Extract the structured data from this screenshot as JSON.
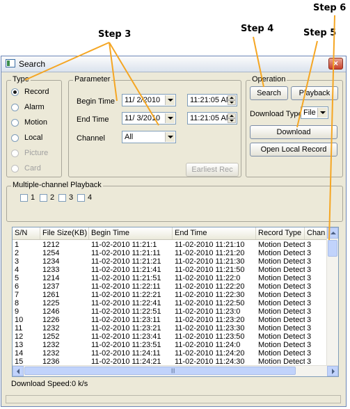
{
  "annotations": {
    "step3": "Step 3",
    "step4": "Step 4",
    "step5": "Step 5",
    "step6": "Step 6"
  },
  "window": {
    "title": "Search",
    "close_label": "×"
  },
  "type_group": {
    "legend": "Type",
    "options": [
      {
        "label": "Record",
        "checked": true,
        "enabled": true
      },
      {
        "label": "Alarm",
        "checked": false,
        "enabled": true
      },
      {
        "label": "Motion",
        "checked": false,
        "enabled": true
      },
      {
        "label": "Local",
        "checked": false,
        "enabled": true
      },
      {
        "label": "Picture",
        "checked": false,
        "enabled": false
      },
      {
        "label": "Card",
        "checked": false,
        "enabled": false
      }
    ]
  },
  "parameter": {
    "legend": "Parameter",
    "begin_label": "Begin Time",
    "begin_date": "11/  2/2010",
    "begin_time": "11:21:05 AM",
    "end_label": "End Time",
    "end_date": "11/  3/2010",
    "end_time": "11:21:05 AM",
    "channel_label": "Channel",
    "channel_value": "All",
    "earliest_button": "Earliest Rec"
  },
  "operation": {
    "legend": "Operation",
    "search_button": "Search",
    "playback_button": "Playback",
    "download_type_label": "Download Type",
    "download_type_value": "File",
    "download_button": "Download",
    "open_local_button": "Open Local Record"
  },
  "multichannel": {
    "legend": "Multiple-channel Playback",
    "channels": [
      "1",
      "2",
      "3",
      "4"
    ]
  },
  "table": {
    "columns": [
      "S/N",
      "File Size(KB)",
      "Begin Time",
      "End Time",
      "Record Type",
      "Chan"
    ],
    "rows": [
      [
        "1",
        "1212",
        "11-02-2010 11:21:1",
        "11-02-2010 11:21:10",
        "Motion Detect",
        "3"
      ],
      [
        "2",
        "1254",
        "11-02-2010 11:21:11",
        "11-02-2010 11:21:20",
        "Motion Detect",
        "3"
      ],
      [
        "3",
        "1234",
        "11-02-2010 11:21:21",
        "11-02-2010 11:21:30",
        "Motion Detect",
        "3"
      ],
      [
        "4",
        "1233",
        "11-02-2010 11:21:41",
        "11-02-2010 11:21:50",
        "Motion Detect",
        "3"
      ],
      [
        "5",
        "1214",
        "11-02-2010 11:21:51",
        "11-02-2010 11:22:0",
        "Motion Detect",
        "3"
      ],
      [
        "6",
        "1237",
        "11-02-2010 11:22:11",
        "11-02-2010 11:22:20",
        "Motion Detect",
        "3"
      ],
      [
        "7",
        "1261",
        "11-02-2010 11:22:21",
        "11-02-2010 11:22:30",
        "Motion Detect",
        "3"
      ],
      [
        "8",
        "1225",
        "11-02-2010 11:22:41",
        "11-02-2010 11:22:50",
        "Motion Detect",
        "3"
      ],
      [
        "9",
        "1246",
        "11-02-2010 11:22:51",
        "11-02-2010 11:23:0",
        "Motion Detect",
        "3"
      ],
      [
        "10",
        "1226",
        "11-02-2010 11:23:11",
        "11-02-2010 11:23:20",
        "Motion Detect",
        "3"
      ],
      [
        "11",
        "1232",
        "11-02-2010 11:23:21",
        "11-02-2010 11:23:30",
        "Motion Detect",
        "3"
      ],
      [
        "12",
        "1252",
        "11-02-2010 11:23:41",
        "11-02-2010 11:23:50",
        "Motion Detect",
        "3"
      ],
      [
        "13",
        "1232",
        "11-02-2010 11:23:51",
        "11-02-2010 11:24:0",
        "Motion Detect",
        "3"
      ],
      [
        "14",
        "1232",
        "11-02-2010 11:24:11",
        "11-02-2010 11:24:20",
        "Motion Detect",
        "3"
      ],
      [
        "15",
        "1236",
        "11-02-2010 11:24:21",
        "11-02-2010 11:24:30",
        "Motion Detect",
        "3"
      ]
    ]
  },
  "status": {
    "download_speed_label": "Download Speed:",
    "download_speed_value": "0 k/s"
  },
  "icons": {
    "title_icon": "window-app-icon",
    "close_icon": "close-icon"
  },
  "colors": {
    "annotation_arrow": "#f5a623",
    "window_bg": "#ece9d8",
    "close_red": "#c8412b"
  }
}
